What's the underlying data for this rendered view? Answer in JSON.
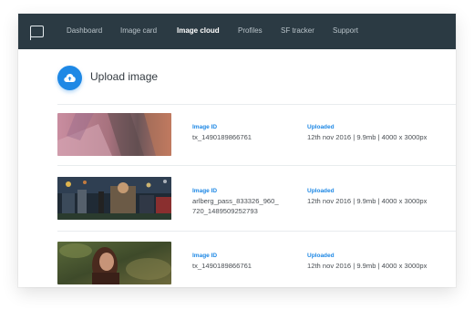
{
  "nav": {
    "items": [
      {
        "label": "Dashboard"
      },
      {
        "label": "Image card"
      },
      {
        "label": "Image cloud"
      },
      {
        "label": "Profiles"
      },
      {
        "label": "SF tracker"
      },
      {
        "label": "Support"
      }
    ],
    "active_item": "Image cloud"
  },
  "upload": {
    "label": "Upload image"
  },
  "images": [
    {
      "id_label": "Image ID",
      "id_value": "tx_1490189866761",
      "uploaded_label": "Uploaded",
      "uploaded_value": "12th nov 2016 | 9.9mb | 4000 x 3000px"
    },
    {
      "id_label": "Image ID",
      "id_value_line1": "arlberg_pass_833326_960_",
      "id_value_line2": "720_1489509252793",
      "uploaded_label": "Uploaded",
      "uploaded_value": "12th nov 2016 | 9.9mb | 4000 x 3000px"
    },
    {
      "id_label": "Image ID",
      "id_value": "tx_1490189866761",
      "uploaded_label": "Uploaded",
      "uploaded_value": "12th nov 2016 | 9.9mb | 4000 x 3000px"
    }
  ],
  "colors": {
    "navbar": "#2b3a43",
    "accent": "#1e88e5"
  }
}
